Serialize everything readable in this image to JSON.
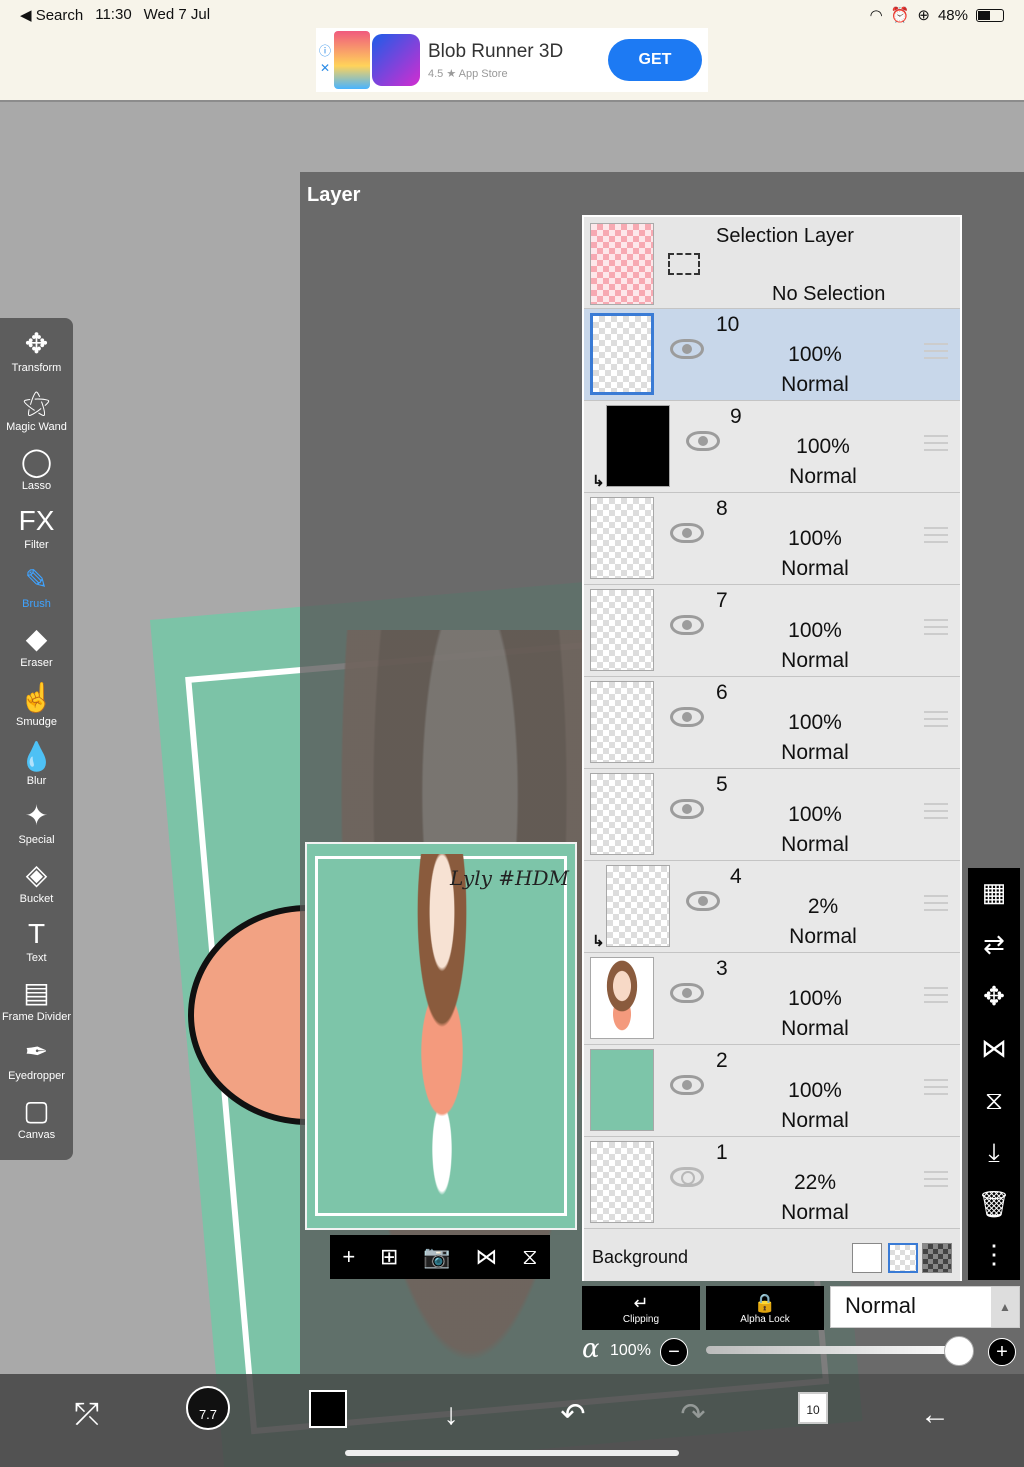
{
  "status": {
    "back_label": "◀ Search",
    "time": "11:30",
    "date": "Wed 7 Jul",
    "battery": "48%"
  },
  "ad": {
    "title": "Blob Runner 3D",
    "rating": "4.5 ★ App Store",
    "cta": "GET"
  },
  "layer_panel": {
    "title": "Layer",
    "selection_layer": {
      "name": "Selection Layer",
      "status": "No Selection"
    },
    "layers": [
      {
        "num": "10",
        "opacity": "100%",
        "mode": "Normal",
        "thumb": "sel",
        "visible": true,
        "clip": false,
        "selected": true
      },
      {
        "num": "9",
        "opacity": "100%",
        "mode": "Normal",
        "thumb": "black",
        "visible": true,
        "clip": true,
        "selected": false
      },
      {
        "num": "8",
        "opacity": "100%",
        "mode": "Normal",
        "thumb": "empty",
        "visible": true,
        "clip": false,
        "selected": false
      },
      {
        "num": "7",
        "opacity": "100%",
        "mode": "Normal",
        "thumb": "empty",
        "visible": true,
        "clip": false,
        "selected": false
      },
      {
        "num": "6",
        "opacity": "100%",
        "mode": "Normal",
        "thumb": "empty",
        "visible": true,
        "clip": false,
        "selected": false
      },
      {
        "num": "5",
        "opacity": "100%",
        "mode": "Normal",
        "thumb": "empty",
        "visible": true,
        "clip": false,
        "selected": false
      },
      {
        "num": "4",
        "opacity": "2%",
        "mode": "Normal",
        "thumb": "empty",
        "visible": true,
        "clip": true,
        "selected": false
      },
      {
        "num": "3",
        "opacity": "100%",
        "mode": "Normal",
        "thumb": "girl",
        "visible": true,
        "clip": false,
        "selected": false
      },
      {
        "num": "2",
        "opacity": "100%",
        "mode": "Normal",
        "thumb": "green",
        "visible": true,
        "clip": false,
        "selected": false
      },
      {
        "num": "1",
        "opacity": "22%",
        "mode": "Normal",
        "thumb": "empty",
        "visible": false,
        "clip": false,
        "selected": false
      }
    ],
    "background_label": "Background",
    "clipping_label": "Clipping",
    "alpha_lock_label": "Alpha Lock",
    "blend_mode": "Normal",
    "alpha_symbol": "α",
    "alpha_value": "100%"
  },
  "preview": {
    "signature": "Lyly #HDM"
  },
  "tools": [
    {
      "name": "transform",
      "label": "Transform",
      "icon": "✥"
    },
    {
      "name": "magic-wand",
      "label": "Magic Wand",
      "icon": "⚝"
    },
    {
      "name": "lasso",
      "label": "Lasso",
      "icon": "◯"
    },
    {
      "name": "filter",
      "label": "Filter",
      "icon": "FX"
    },
    {
      "name": "brush",
      "label": "Brush",
      "icon": "✎"
    },
    {
      "name": "eraser",
      "label": "Eraser",
      "icon": "◆"
    },
    {
      "name": "smudge",
      "label": "Smudge",
      "icon": "☝"
    },
    {
      "name": "blur",
      "label": "Blur",
      "icon": "💧"
    },
    {
      "name": "special",
      "label": "Special",
      "icon": "✦"
    },
    {
      "name": "bucket",
      "label": "Bucket",
      "icon": "◈"
    },
    {
      "name": "text",
      "label": "Text",
      "icon": "T"
    },
    {
      "name": "frame-divider",
      "label": "Frame Divider",
      "icon": "▤"
    },
    {
      "name": "eyedropper",
      "label": "Eyedropper",
      "icon": "✒"
    },
    {
      "name": "canvas",
      "label": "Canvas",
      "icon": "▢"
    }
  ],
  "active_tool": "brush",
  "bottom": {
    "brush_size": "7.7",
    "layer_count": "10"
  },
  "colors": {
    "accent": "#3a7bd5",
    "active_tool": "#3fa3ff",
    "canvas_green": "#7dc5a9"
  }
}
